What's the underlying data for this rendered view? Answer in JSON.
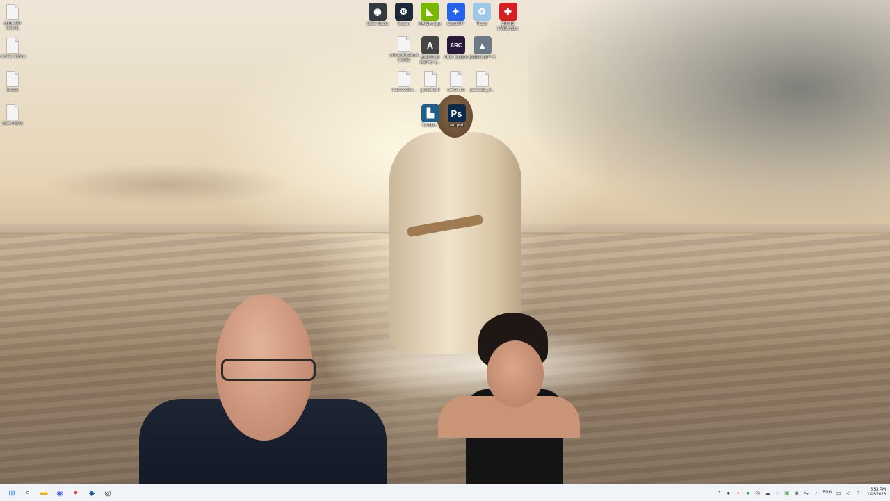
{
  "desktop": {
    "left_icons": [
      {
        "label": "computer files.txt",
        "icon": "text-file-icon"
      },
      {
        "label": "camera outline",
        "icon": "text-file-icon"
      },
      {
        "label": "braces",
        "icon": "text-file-icon"
      },
      {
        "label": "code notes",
        "icon": "text-file-icon"
      }
    ],
    "top_icons_row1": [
      {
        "label": "OBS Studio",
        "icon": "obs-icon",
        "glyph": "◉",
        "color": "#333a40"
      },
      {
        "label": "Steam",
        "icon": "steam-icon",
        "glyph": "⚙",
        "color": "#1b2838"
      },
      {
        "label": "NVIDIA App",
        "icon": "nvidia-icon",
        "glyph": "◣",
        "color": "#76b900"
      },
      {
        "label": "ChatGPT",
        "icon": "chatgpt-icon",
        "glyph": "✦",
        "color": "#2563eb"
      },
      {
        "label": "Trash",
        "icon": "recycle-bin-icon",
        "glyph": "♻",
        "color": "#9fc7e6"
      },
      {
        "label": "CPUID HWMonitor",
        "icon": "hwmonitor-icon",
        "glyph": "✚",
        "color": "#d42020"
      }
    ],
    "top_icons_row2": [
      {
        "label": "arena Breakout Infinite",
        "icon": "text-file-icon"
      },
      {
        "label": "Battlefield Games 1...",
        "icon": "battlefield-icon",
        "glyph": "A",
        "color": "#444"
      },
      {
        "label": "ARC Raiders",
        "icon": "arc-raiders-icon",
        "glyph": "ARC",
        "color": "#2a1a3a"
      },
      {
        "label": "Battlefield™ 6",
        "icon": "battlefield6-icon",
        "glyph": "▲",
        "color": "#6b7a85"
      }
    ],
    "top_icons_row3": [
      {
        "label": "macrovoice...",
        "icon": "text-file-icon"
      },
      {
        "label": "gravebord",
        "icon": "text-file-icon"
      },
      {
        "label": "cortex.txt",
        "icon": "text-file-icon"
      },
      {
        "label": "palisade_d...",
        "icon": "text-file-icon"
      }
    ],
    "top_icons_row4": [
      {
        "label": "Render...",
        "icon": "kindle-icon",
        "glyph": "▙",
        "color": "#1d5f8a"
      },
      {
        "label": "arc.psd",
        "icon": "photoshop-icon",
        "glyph": "Ps",
        "color": "#0b2a4a"
      }
    ]
  },
  "taskbar": {
    "apps": [
      {
        "name": "windows-start-icon",
        "glyph": "⊞",
        "color": "#0a66d8"
      },
      {
        "name": "search-icon",
        "glyph": "⌕",
        "color": "#333"
      },
      {
        "name": "file-explorer-icon",
        "glyph": "▬",
        "color": "#f2b600"
      },
      {
        "name": "discord-icon",
        "glyph": "◉",
        "color": "#5865f2"
      },
      {
        "name": "chrome-icon",
        "glyph": "●",
        "color": "#e84a3c"
      },
      {
        "name": "vscode-icon",
        "glyph": "◆",
        "color": "#1f5f9e"
      },
      {
        "name": "obs-taskbar-icon",
        "glyph": "◎",
        "color": "#333"
      }
    ],
    "tray": {
      "language": "ENG",
      "time": "5:53 PM",
      "date": "1/13/2026"
    }
  }
}
